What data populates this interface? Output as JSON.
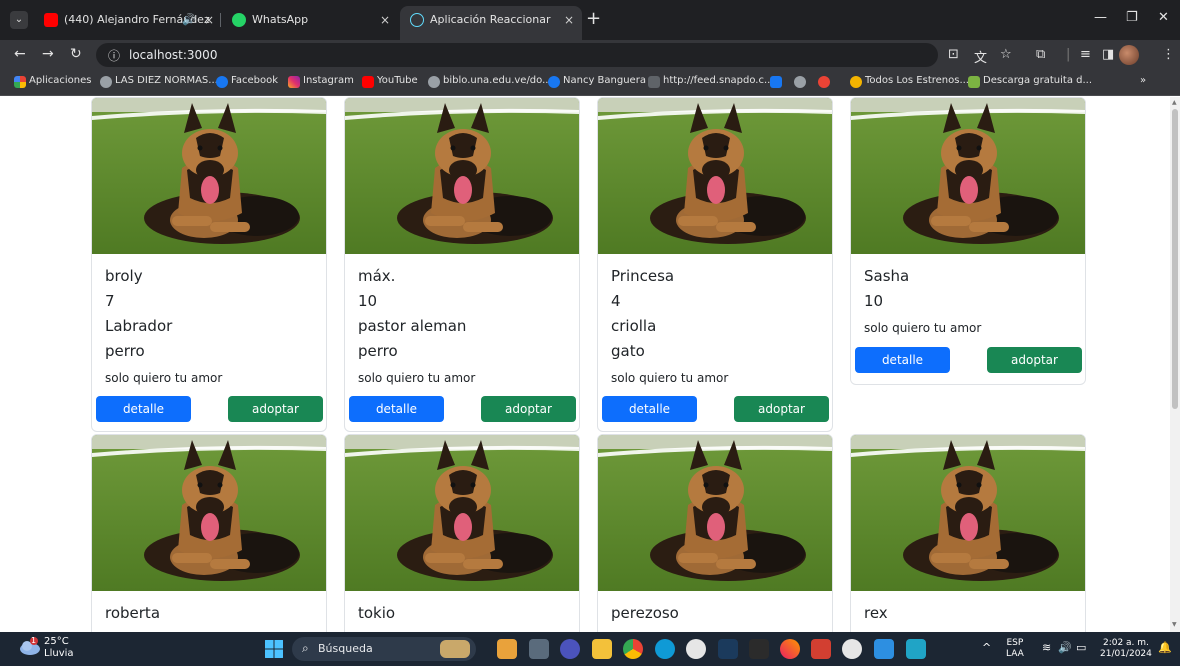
{
  "browser": {
    "tabs": [
      {
        "label": "(440) Alejandro Fernández",
        "icon": "youtube-icon",
        "color": "#ff0000"
      },
      {
        "label": "WhatsApp",
        "icon": "whatsapp-icon",
        "color": "#25d366"
      },
      {
        "label": "Aplicación Reaccionar",
        "icon": "react-icon",
        "color": "#61dafb"
      }
    ],
    "url": "localhost:3000",
    "bookmarks": [
      {
        "label": "Aplicaciones",
        "color": "#fbbc04"
      },
      {
        "label": "LAS DIEZ NORMAS...",
        "color": "#9aa0a6"
      },
      {
        "label": "Facebook",
        "color": "#1877f2"
      },
      {
        "label": "Instagram",
        "color": "#e1306c"
      },
      {
        "label": "YouTube",
        "color": "#ff0000"
      },
      {
        "label": "biblo.una.edu.ve/do...",
        "color": "#9aa0a6"
      },
      {
        "label": "Nancy Banguera",
        "color": "#1877f2"
      },
      {
        "label": "http://feed.snapdo.c...",
        "color": "#5f6368"
      },
      {
        "label": "Todos Los Estrenos...",
        "color": "#f4b400"
      },
      {
        "label": "Descarga gratuita d...",
        "color": "#7cb342"
      }
    ],
    "overflow": "»"
  },
  "pets": [
    {
      "name": "broly",
      "age": "7",
      "breed": "Labrador",
      "type": "perro",
      "description": "solo quiero tu amor"
    },
    {
      "name": "máx.",
      "age": "10",
      "breed": "pastor aleman",
      "type": "perro",
      "description": "solo quiero tu amor"
    },
    {
      "name": "Princesa",
      "age": "4",
      "breed": "criolla",
      "type": "gato",
      "description": "solo quiero tu amor"
    },
    {
      "name": "Sasha",
      "age": "10",
      "description": "solo quiero tu amor"
    },
    {
      "name": "roberta"
    },
    {
      "name": "tokio"
    },
    {
      "name": "perezoso"
    },
    {
      "name": "rex"
    }
  ],
  "buttons": {
    "detail": "detalle",
    "adopt": "adoptar"
  },
  "colors": {
    "detail": "#0d6efd",
    "adopt": "#198754"
  },
  "taskbar": {
    "temperature": "25°C",
    "weather": "Lluvia",
    "search": "Búsqueda",
    "lang1": "ESP",
    "lang2": "LAA",
    "time": "2:02 a. m.",
    "date": "21/01/2024",
    "badge": "1"
  }
}
